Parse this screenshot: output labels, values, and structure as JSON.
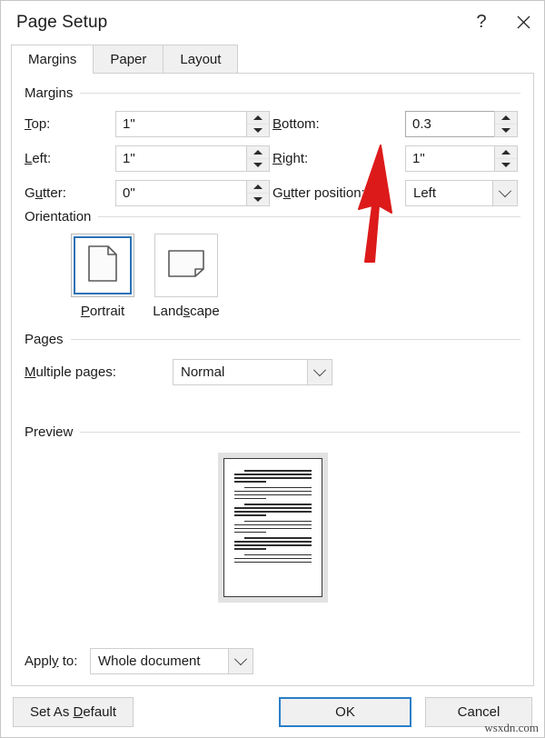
{
  "window": {
    "title": "Page Setup",
    "help_icon": "question-mark-icon",
    "help_glyph": "?",
    "close_icon": "close-icon"
  },
  "tabs": [
    {
      "label": "Margins",
      "active": true
    },
    {
      "label": "Paper",
      "active": false
    },
    {
      "label": "Layout",
      "active": false
    }
  ],
  "margins_group": {
    "label": "Margins",
    "fields": {
      "top": {
        "label_pre": "",
        "label_accel": "T",
        "label_post": "op:",
        "value": "1\""
      },
      "bottom": {
        "label_pre": "",
        "label_accel": "B",
        "label_post": "ottom:",
        "value": "0.3"
      },
      "left": {
        "label_pre": "",
        "label_accel": "L",
        "label_post": "eft:",
        "value": "1\""
      },
      "right": {
        "label_pre": "",
        "label_accel": "R",
        "label_post": "ight:",
        "value": "1\""
      },
      "gutter": {
        "label_pre": "G",
        "label_accel": "u",
        "label_post": "tter:",
        "value": "0\""
      },
      "gutter_position": {
        "label_pre": "G",
        "label_accel": "u",
        "label_post": "tter position:",
        "value": "Left"
      }
    }
  },
  "orientation_group": {
    "label": "Orientation",
    "options": [
      {
        "caption_pre": "",
        "caption_accel": "P",
        "caption_post": "ortrait",
        "selected": true,
        "icon": "portrait-page-icon"
      },
      {
        "caption_pre": "Land",
        "caption_accel": "s",
        "caption_post": "cape",
        "selected": false,
        "icon": "landscape-page-icon"
      }
    ]
  },
  "pages_group": {
    "label": "Pages",
    "multiple_pages": {
      "label_pre": "",
      "label_accel": "M",
      "label_post": "ultiple pages:",
      "value": "Normal"
    }
  },
  "preview_group": {
    "label": "Preview",
    "page_paragraphs": 6
  },
  "apply_to": {
    "label_pre": "Appl",
    "label_accel": "y",
    "label_post": " to:",
    "value": "Whole document"
  },
  "footer": {
    "set_as_default": {
      "pre": "Set As ",
      "accel": "D",
      "post": "efault"
    },
    "ok": "OK",
    "cancel": "Cancel"
  },
  "annotation": {
    "type": "red-arrow",
    "color": "#dd1a1a",
    "points_to": "bottom-margin-field"
  },
  "watermark": "wsxdn.com",
  "colors": {
    "accent_blue": "#2a7fc9",
    "selection_blue": "#2a72b5",
    "dialog_bg": "#ffffff",
    "control_bg": "#f0f0f0",
    "border": "#cfcfcf",
    "annotation_red": "#dd1a1a"
  }
}
